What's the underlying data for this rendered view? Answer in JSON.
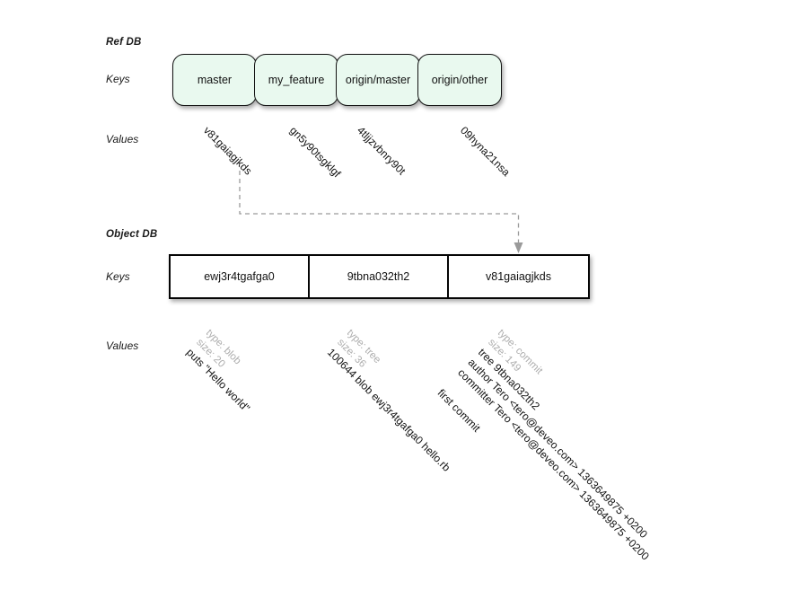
{
  "diagram": {
    "sections": [
      {
        "id": "ref-db",
        "title": "Ref DB"
      },
      {
        "id": "object-db",
        "title": "Object DB"
      }
    ],
    "row_labels": {
      "keys": "Keys",
      "values": "Values"
    },
    "colors": {
      "ref_key_fill": "#e9f9ef",
      "ref_key_border": "#121212",
      "obj_key_fill": "#ffffff",
      "obj_key_border": "#050505",
      "meta_text": "#adadad",
      "body_text": "#111111",
      "connector": "#9a9a9a",
      "background": "#ffffff"
    }
  },
  "ref_db": {
    "title": "Ref DB",
    "keys_label": "Keys",
    "values_label": "Values",
    "entries": [
      {
        "key": "master",
        "value": "v81gaiagjkds"
      },
      {
        "key": "my_feature",
        "value": "gn5y90tsgklgf"
      },
      {
        "key": "origin/master",
        "value": "4tljjzvbnry90t"
      },
      {
        "key": "origin/other",
        "value": "09hyna21nsa"
      }
    ]
  },
  "object_db": {
    "title": "Object DB",
    "keys_label": "Keys",
    "values_label": "Values",
    "entries": [
      {
        "key": "ewj3r4tgafga0",
        "meta": [
          "type: blob",
          "size: 20"
        ],
        "body": [
          "puts \"Hello world\""
        ]
      },
      {
        "key": "9tbna032th2",
        "meta": [
          "type: tree",
          "size: 36"
        ],
        "body": [
          "100644 blob ewj3r4tgafga0  hello.rb"
        ]
      },
      {
        "key": "v81gaiagjkds",
        "meta": [
          "type: commit",
          "size: 149"
        ],
        "body": [
          "tree 9tbna032th2",
          "author Tero <tero@deveo.com> 1363649875 +0200",
          "committer Tero <tero@deveo.com> 1363649875 +0200",
          "",
          "first commit"
        ]
      }
    ]
  },
  "connector": {
    "from_ref_value": "v81gaiagjkds",
    "to_object_key": "v81gaiagjkds",
    "style": "dashed",
    "arrowhead": "down"
  }
}
